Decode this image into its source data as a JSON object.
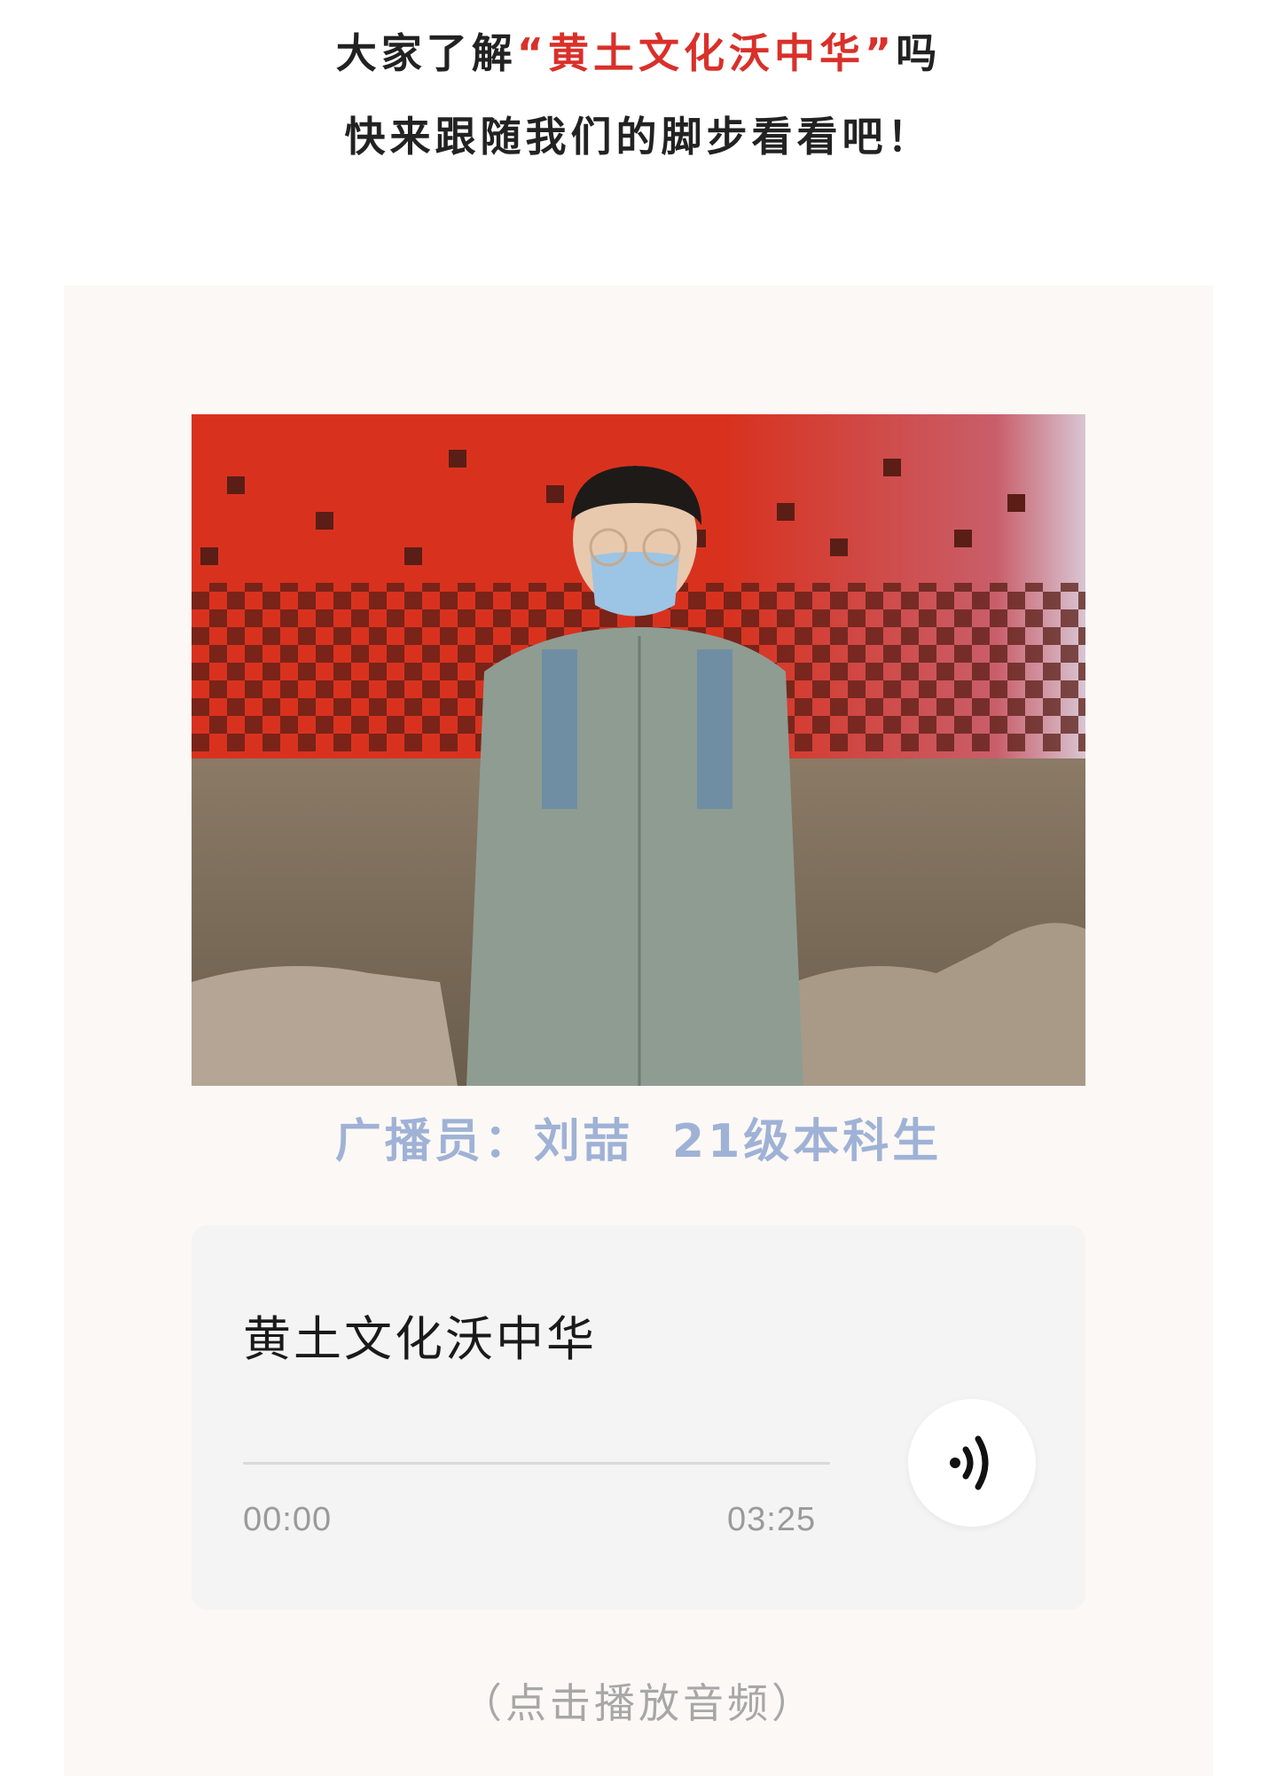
{
  "intro": {
    "line1_before": "大家了解",
    "line1_highlight": "“黄土文化沃中华”",
    "line1_after": "吗",
    "line2": "快来跟随我们的脚步看看吧！"
  },
  "photo": {
    "description_icon": "photo-of-announcer"
  },
  "caption": "广播员：刘喆  21级本科生",
  "player": {
    "title": "黄土文化沃中华",
    "progress": 0,
    "current_time": "00:00",
    "total_time": "03:25",
    "play_icon": "audio-wave-icon"
  },
  "hint": "（点击播放音频）",
  "colors": {
    "highlight": "#d9302a",
    "caption": "#9fb2d6",
    "card_bg": "#fcf8f5",
    "player_bg": "#f4f4f4"
  }
}
